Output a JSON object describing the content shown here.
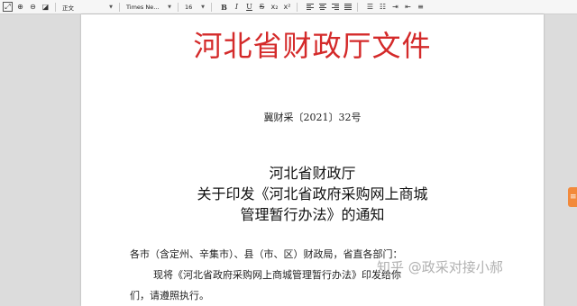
{
  "toolbar": {
    "style_select": "正文",
    "font_select": "Times Ne...",
    "size_select": "16",
    "bold": "B",
    "italic": "I",
    "underline": "U",
    "strike": "S"
  },
  "document": {
    "title": "河北省财政厅文件",
    "number": "冀财采〔2021〕32号",
    "heading_line1": "河北省财政厅",
    "heading_line2": "关于印发《河北省政府采购网上商城",
    "heading_line3": "管理暂行办法》的通知",
    "para1": "各市（含定州、辛集市）、县（市、区）财政局，省直各部门：",
    "para2": "现将《河北省政府采购网上商城管理暂行办法》印发给你",
    "para3": "们，请遵照执行。"
  },
  "watermark": "知乎 @政采对接小郝",
  "colors": {
    "title_red": "#d42a2a",
    "side_widget": "#f28a3c"
  }
}
